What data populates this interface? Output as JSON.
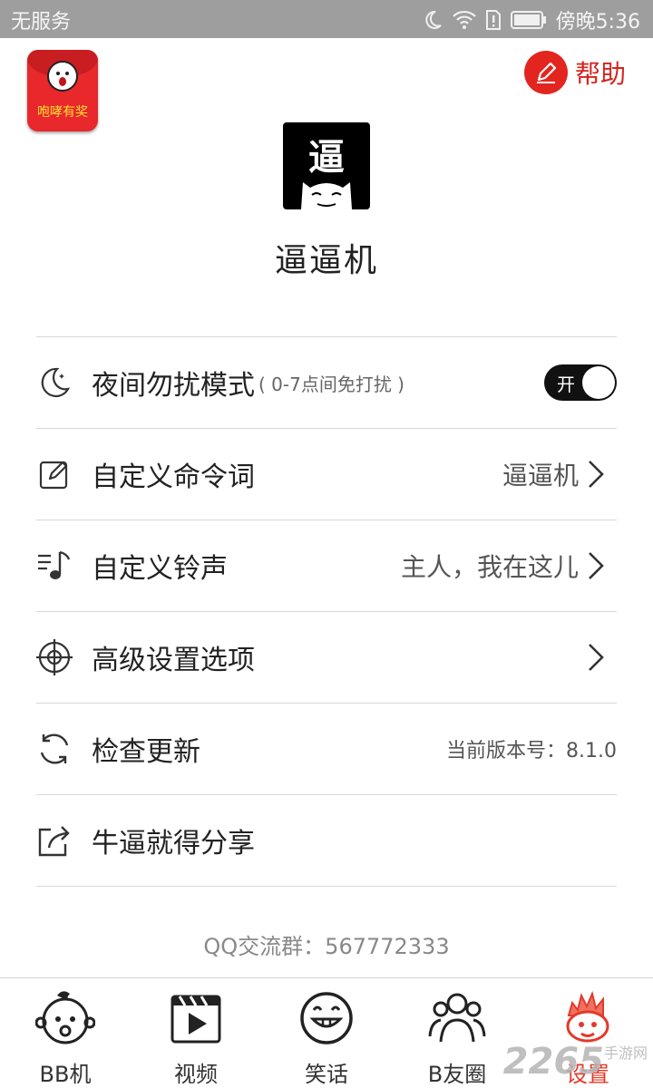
{
  "status_bar": {
    "carrier": "无服务",
    "time": "傍晚5:36"
  },
  "header": {
    "redpacket_label": "咆哮有奖",
    "help_label": "帮助"
  },
  "app": {
    "logo_char": "逼",
    "name": "逼逼机"
  },
  "settings": {
    "night_mode": {
      "label": "夜间勿扰模式",
      "sub": "( 0-7点间免打扰 )",
      "toggle_text": "开",
      "enabled": true
    },
    "custom_command": {
      "label": "自定义命令词",
      "value": "逼逼机"
    },
    "custom_ringtone": {
      "label": "自定义铃声",
      "value": "主人，我在这儿"
    },
    "advanced": {
      "label": "高级设置选项"
    },
    "check_update": {
      "label": "检查更新",
      "value": "当前版本号：8.1.0"
    },
    "share": {
      "label": "牛逼就得分享"
    }
  },
  "qq_group": "QQ交流群：567772333",
  "tabs": [
    {
      "label": "BB机",
      "icon": "baby-face-icon"
    },
    {
      "label": "视频",
      "icon": "video-play-icon"
    },
    {
      "label": "笑话",
      "icon": "grin-face-icon"
    },
    {
      "label": "B友圈",
      "icon": "friends-icon"
    },
    {
      "label": "设置",
      "icon": "settings-mascot-icon"
    }
  ],
  "active_tab": 4,
  "watermark": {
    "main": "2265",
    "sub": "手游网"
  },
  "colors": {
    "accent": "#e23a2a",
    "status_bar": "#9e9e9e",
    "toggle_on": "#111111"
  }
}
